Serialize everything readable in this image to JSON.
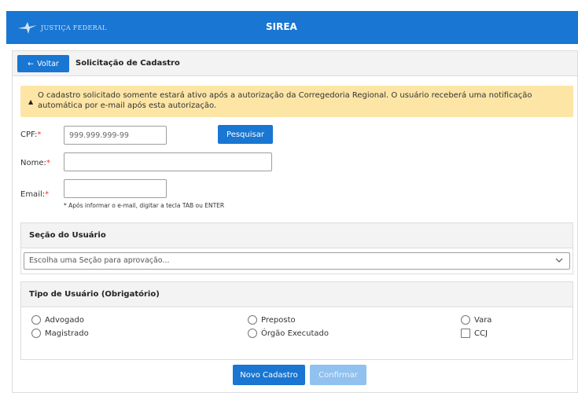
{
  "header": {
    "logo_text": "JUSTIÇA FEDERAL",
    "app_title": "SIREA",
    "color": "#1976d2"
  },
  "page": {
    "back_label": "Voltar",
    "title": "Solicitação de Cadastro"
  },
  "alert": {
    "text": "O cadastro solicitado somente estará ativo após a autorização da Corregedoria Regional. O usuário receberá uma notificação automática por e-mail após esta autorização.",
    "color": "#fde5a6"
  },
  "form": {
    "cpf_label": "CPF:",
    "cpf_placeholder": "999.999.999-99",
    "search_label": "Pesquisar",
    "nome_label": "Nome:",
    "email_label": "Email:",
    "required_mark": "*",
    "email_hint": "* Após informar o e-mail, digitar a tecla TAB ou ENTER"
  },
  "secao": {
    "title": "Seção do Usuário",
    "select_placeholder": "Escolha uma Seção para aprovação..."
  },
  "tipo": {
    "title": "Tipo de Usuário (Obrigatório)",
    "options": [
      {
        "label": "Advogado",
        "control": "radio"
      },
      {
        "label": "Magistrado",
        "control": "radio"
      },
      {
        "label": "Preposto",
        "control": "radio"
      },
      {
        "label": "Órgão Executado",
        "control": "radio"
      },
      {
        "label": "Vara",
        "control": "radio"
      },
      {
        "label": "CCJ",
        "control": "checkbox"
      }
    ]
  },
  "actions": {
    "novo_label": "Novo Cadastro",
    "confirmar_label": "Confirmar"
  }
}
